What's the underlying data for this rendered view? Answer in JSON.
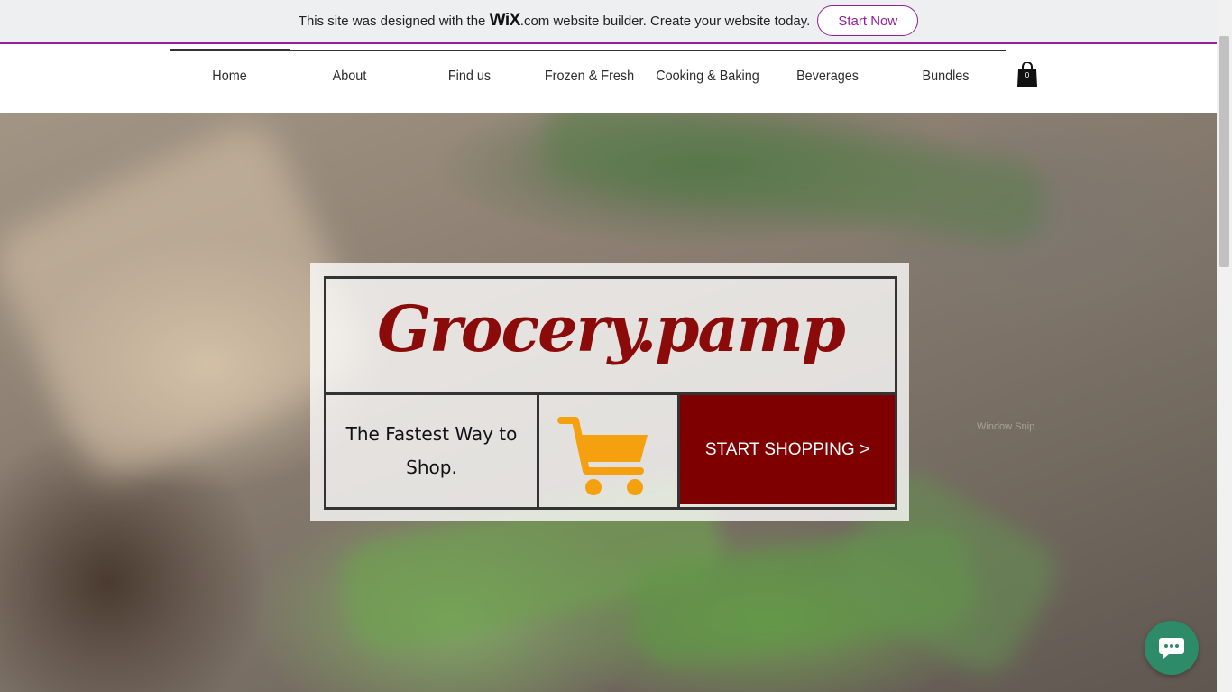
{
  "wix_banner": {
    "text_before": "This site was designed with the",
    "brand": "WiX",
    "text_after": ".com website builder. Create your website today.",
    "start_label": "Start Now",
    "accent_color": "#931f9a"
  },
  "nav": {
    "items": [
      {
        "label": "Home",
        "active": true
      },
      {
        "label": "About"
      },
      {
        "label": "Find us"
      },
      {
        "label": "Frozen & Fresh"
      },
      {
        "label": "Cooking & Baking"
      },
      {
        "label": "Beverages"
      },
      {
        "label": "Bundles"
      }
    ],
    "cart_count": "0",
    "cart_icon": "shopping-bag-icon"
  },
  "hero": {
    "title": "Grocery.pamp",
    "tagline": "The Fastest Way to Shop.",
    "cta_label": "START SHOPPING >",
    "cart_icon": "shopping-cart-icon",
    "ghost_text": "Window Snip",
    "colors": {
      "title": "#8b0a0a",
      "cta_bg": "#7f0000",
      "cart": "#f5a00f"
    }
  },
  "chat": {
    "icon": "chat-bubble-icon",
    "color": "#2e8b6a"
  }
}
